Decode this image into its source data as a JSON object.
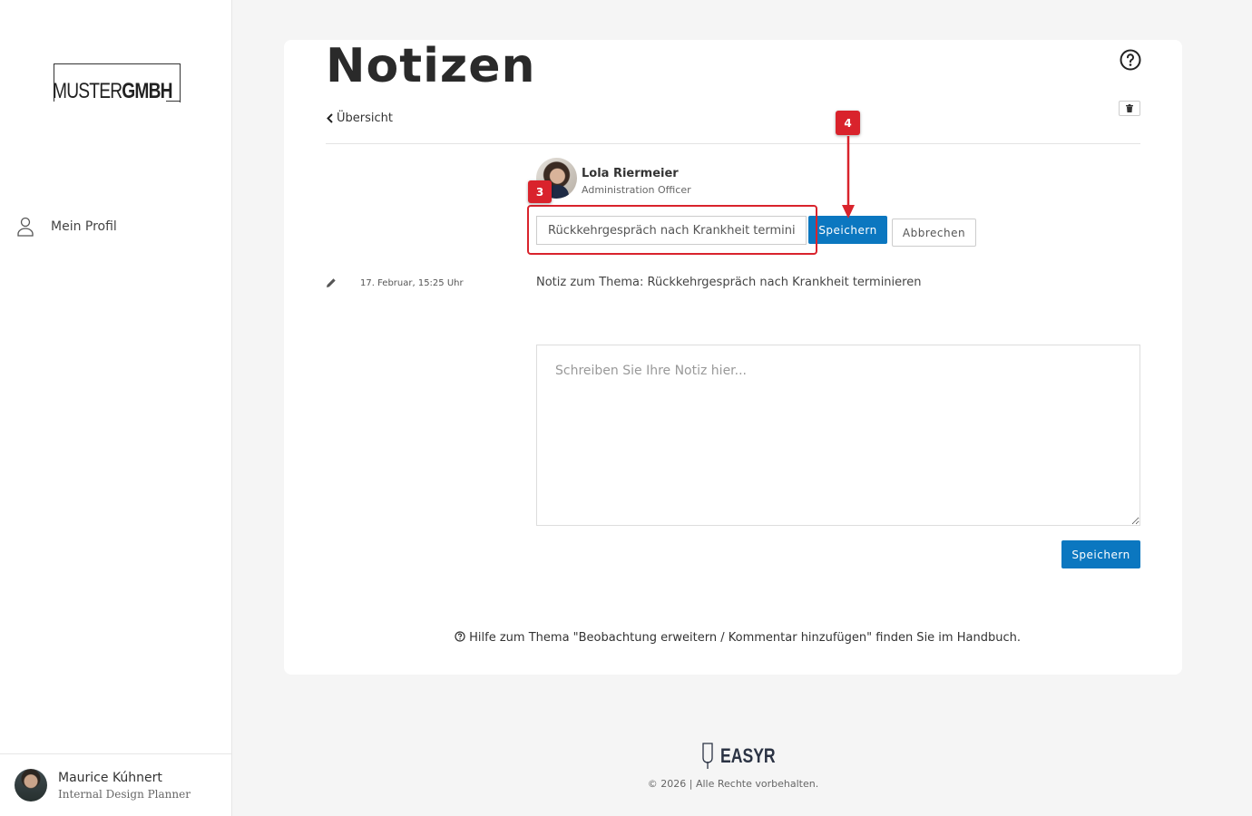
{
  "sidebar": {
    "logo": {
      "part1": "MUSTER",
      "part2": "GMBH"
    },
    "nav": [
      {
        "label": "Mein Profil"
      }
    ],
    "user": {
      "name": "Maurice Kúhnert",
      "role": "Internal Design Planner"
    }
  },
  "main": {
    "title": "Notizen",
    "back_label": "Übersicht",
    "author": {
      "name": "Lola Riermeier",
      "role": "Administration Officer"
    },
    "topic_input": {
      "value": "Rückkehrgespräch nach Krankheit terminieren"
    },
    "save_inline_label": "Speichern",
    "cancel_inline_label": "Abbrechen",
    "note": {
      "date": "17. Februar, 15:25 Uhr",
      "text": "Notiz zum Thema: Rückkehrgespräch nach Krankheit terminieren"
    },
    "textarea": {
      "placeholder": "Schreiben Sie Ihre Notiz hier..."
    },
    "save_main_label": "Speichern",
    "help_text": "Hilfe zum Thema \"Beobachtung erweitern / Kommentar hinzufügen\" finden Sie im Handbuch."
  },
  "annotations": {
    "badge_3": "3",
    "badge_4": "4",
    "color": "#d9232c"
  },
  "footer": {
    "brand": "EASYR",
    "copyright": "© 2026 | Alle Rechte vorbehalten."
  },
  "colors": {
    "primary": "#0b77c0",
    "accent_red": "#d9232c"
  }
}
